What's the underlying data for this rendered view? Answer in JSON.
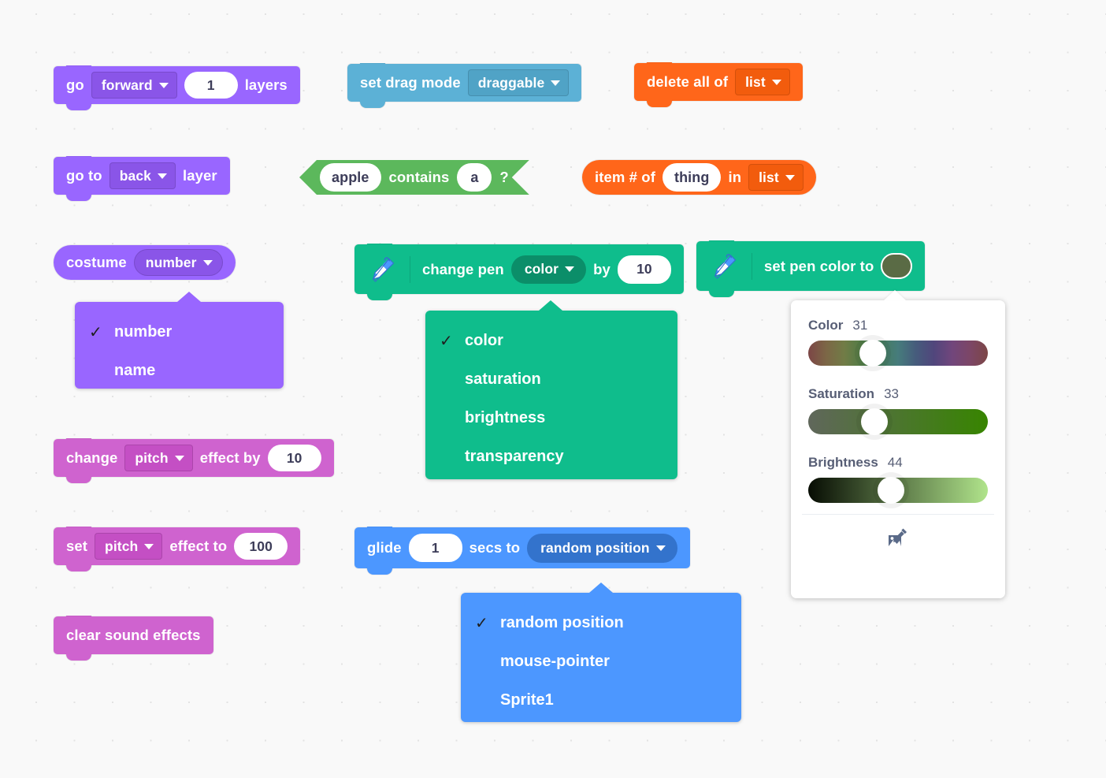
{
  "page": {
    "title": "Scratch Blocks Palette Preview",
    "background_color": "#f9f9f9"
  },
  "blocks": {
    "go_forward_layers": {
      "prefix": "go",
      "dropdown": "forward",
      "value": "1",
      "suffix": "layers",
      "color": "#9966ff"
    },
    "set_drag_mode": {
      "prefix": "set drag mode",
      "dropdown": "draggable",
      "color": "#5cb1d6"
    },
    "delete_all_of": {
      "prefix": "delete all of",
      "dropdown": "list",
      "color": "#ff661a"
    },
    "go_to_back_layer": {
      "prefix": "go to",
      "dropdown": "back",
      "suffix": "layer",
      "color": "#9966ff"
    },
    "contains": {
      "first": "apple",
      "middle": "contains",
      "second": "a",
      "suffix": "?",
      "color": "#5cb85c"
    },
    "item_number_of": {
      "prefix": "item # of",
      "value": "thing",
      "middle": "in",
      "dropdown": "list",
      "color": "#ff661a"
    },
    "costume_number": {
      "prefix": "costume",
      "dropdown": "number",
      "color": "#9966ff"
    },
    "change_pen_by": {
      "icon": "pen-icon",
      "prefix": "change pen",
      "dropdown": "color",
      "middle": "by",
      "value": "10",
      "color": "#0fbd8c"
    },
    "set_pen_color_to": {
      "icon": "pen-icon",
      "prefix": "set pen color to",
      "swatch_color": "#5a6b45",
      "color": "#0fbd8c"
    },
    "change_pitch_effect_by": {
      "prefix": "change",
      "dropdown": "pitch",
      "middle": "effect by",
      "value": "10",
      "color": "#cf63cf"
    },
    "set_pitch_effect_to": {
      "prefix": "set",
      "dropdown": "pitch",
      "middle": "effect to",
      "value": "100",
      "color": "#cf63cf"
    },
    "clear_sound_effects": {
      "label": "clear sound effects",
      "color": "#cf63cf"
    },
    "glide_secs_to": {
      "prefix": "glide",
      "value": "1",
      "middle": "secs to",
      "dropdown": "random position",
      "color": "#4c97ff"
    }
  },
  "menus": {
    "costume_menu": {
      "color": "#9966ff",
      "items": [
        {
          "label": "number",
          "checked": true
        },
        {
          "label": "name",
          "checked": false
        }
      ]
    },
    "pen_param_menu": {
      "color": "#0fbd8c",
      "items": [
        {
          "label": "color",
          "checked": true
        },
        {
          "label": "saturation",
          "checked": false
        },
        {
          "label": "brightness",
          "checked": false
        },
        {
          "label": "transparency",
          "checked": false
        }
      ]
    },
    "glide_target_menu": {
      "color": "#4c97ff",
      "items": [
        {
          "label": "random position",
          "checked": true
        },
        {
          "label": "mouse-pointer",
          "checked": false
        },
        {
          "label": "Sprite1",
          "checked": false
        }
      ]
    }
  },
  "color_picker": {
    "sliders": [
      {
        "name": "Color",
        "value": "31",
        "percent": 36
      },
      {
        "name": "Saturation",
        "value": "33",
        "percent": 37
      },
      {
        "name": "Brightness",
        "value": "44",
        "percent": 46
      }
    ],
    "eyedropper_icon": "eyedropper-icon"
  },
  "check_glyph": "✓"
}
